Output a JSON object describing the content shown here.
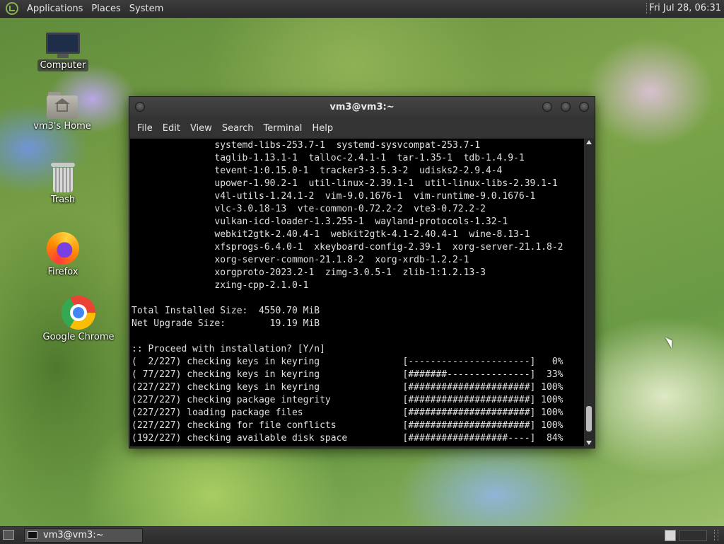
{
  "top_panel": {
    "menus": [
      "Applications",
      "Places",
      "System"
    ],
    "clock": "Fri Jul 28, 06:31"
  },
  "desktop_icons": [
    {
      "label": "Computer",
      "icon": "computer-icon"
    },
    {
      "label": "vm3's Home",
      "icon": "home-folder-icon"
    },
    {
      "label": "Trash",
      "icon": "trash-icon"
    },
    {
      "label": "Firefox",
      "icon": "firefox-icon"
    },
    {
      "label": "Google Chrome",
      "icon": "chrome-icon"
    }
  ],
  "terminal": {
    "title": "vm3@vm3:~",
    "menu": [
      "File",
      "Edit",
      "View",
      "Search",
      "Terminal",
      "Help"
    ],
    "lines": [
      "               systemd-libs-253.7-1  systemd-sysvcompat-253.7-1",
      "               taglib-1.13.1-1  talloc-2.4.1-1  tar-1.35-1  tdb-1.4.9-1",
      "               tevent-1:0.15.0-1  tracker3-3.5.3-2  udisks2-2.9.4-4",
      "               upower-1.90.2-1  util-linux-2.39.1-1  util-linux-libs-2.39.1-1",
      "               v4l-utils-1.24.1-2  vim-9.0.1676-1  vim-runtime-9.0.1676-1",
      "               vlc-3.0.18-13  vte-common-0.72.2-2  vte3-0.72.2-2",
      "               vulkan-icd-loader-1.3.255-1  wayland-protocols-1.32-1",
      "               webkit2gtk-2.40.4-1  webkit2gtk-4.1-2.40.4-1  wine-8.13-1",
      "               xfsprogs-6.4.0-1  xkeyboard-config-2.39-1  xorg-server-21.1.8-2",
      "               xorg-server-common-21.1.8-2  xorg-xrdb-1.2.2-1",
      "               xorgproto-2023.2-1  zimg-3.0.5-1  zlib-1:1.2.13-3",
      "               zxing-cpp-2.1.0-1",
      "",
      "Total Installed Size:  4550.70 MiB",
      "Net Upgrade Size:        19.19 MiB",
      "",
      ":: Proceed with installation? [Y/n]",
      "(  2/227) checking keys in keyring               [----------------------]   0%",
      "( 77/227) checking keys in keyring               [#######---------------]  33%",
      "(227/227) checking keys in keyring               [######################] 100%",
      "(227/227) checking package integrity             [######################] 100%",
      "(227/227) loading package files                  [######################] 100%",
      "(227/227) checking for file conflicts            [######################] 100%",
      "(192/227) checking available disk space          [##################----]  84%"
    ]
  },
  "taskbar": {
    "task_label": "vm3@vm3:~"
  }
}
